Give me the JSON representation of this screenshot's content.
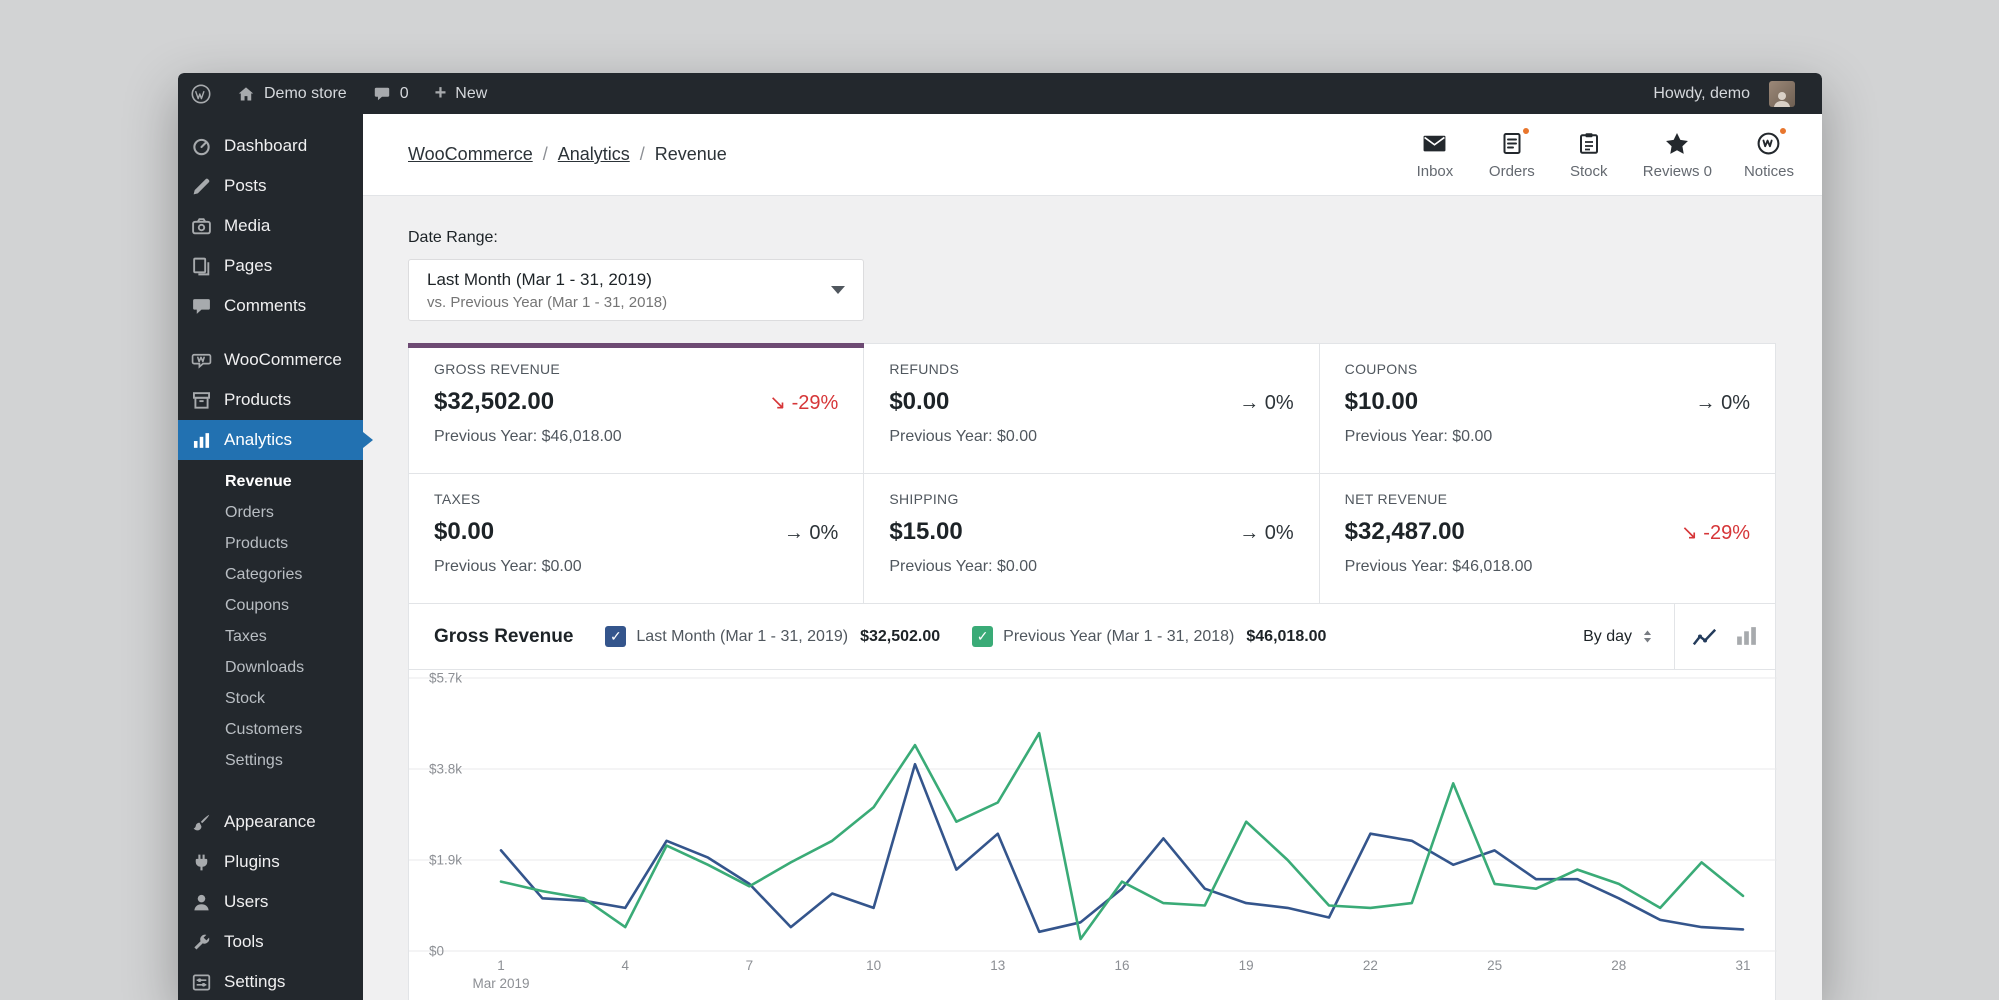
{
  "colors": {
    "accent": "#6d4a73",
    "series_current": "#34558c",
    "series_previous": "#3aab77",
    "negative": "#d63638",
    "badge": "#e8762d",
    "active_menu": "#2271b1"
  },
  "admin_bar": {
    "site_name": "Demo store",
    "comments_count": "0",
    "new_prefix": "+",
    "new_label": "New",
    "howdy": "Howdy, demo"
  },
  "sidebar": {
    "items": [
      {
        "label": "Dashboard"
      },
      {
        "label": "Posts"
      },
      {
        "label": "Media"
      },
      {
        "label": "Pages"
      },
      {
        "label": "Comments"
      },
      {
        "label": "WooCommerce"
      },
      {
        "label": "Products"
      },
      {
        "label": "Analytics"
      },
      {
        "label": "Appearance"
      },
      {
        "label": "Plugins"
      },
      {
        "label": "Users"
      },
      {
        "label": "Tools"
      },
      {
        "label": "Settings"
      }
    ],
    "analytics_submenu": [
      {
        "label": "Revenue"
      },
      {
        "label": "Orders"
      },
      {
        "label": "Products"
      },
      {
        "label": "Categories"
      },
      {
        "label": "Coupons"
      },
      {
        "label": "Taxes"
      },
      {
        "label": "Downloads"
      },
      {
        "label": "Stock"
      },
      {
        "label": "Customers"
      },
      {
        "label": "Settings"
      }
    ]
  },
  "breadcrumb": {
    "root": "WooCommerce",
    "section": "Analytics",
    "current": "Revenue",
    "separator": "/"
  },
  "activity": {
    "inbox": "Inbox",
    "orders": "Orders",
    "stock": "Stock",
    "reviews": "Reviews 0",
    "notices": "Notices"
  },
  "date_range": {
    "label": "Date Range:",
    "primary": "Last Month (Mar 1 - 31, 2019)",
    "secondary": "vs. Previous Year (Mar 1 - 31, 2018)"
  },
  "summary_cards": [
    {
      "label": "GROSS REVENUE",
      "value": "$32,502.00",
      "arrow": "↘",
      "pct": "-29%",
      "previous": "Previous Year: $46,018.00"
    },
    {
      "label": "REFUNDS",
      "value": "$0.00",
      "arrow": "→",
      "pct": "0%",
      "previous": "Previous Year: $0.00"
    },
    {
      "label": "COUPONS",
      "value": "$10.00",
      "arrow": "→",
      "pct": "0%",
      "previous": "Previous Year: $0.00"
    },
    {
      "label": "TAXES",
      "value": "$0.00",
      "arrow": "→",
      "pct": "0%",
      "previous": "Previous Year: $0.00"
    },
    {
      "label": "SHIPPING",
      "value": "$15.00",
      "arrow": "→",
      "pct": "0%",
      "previous": "Previous Year: $0.00"
    },
    {
      "label": "NET REVENUE",
      "value": "$32,487.00",
      "arrow": "↘",
      "pct": "-29%",
      "previous": "Previous Year: $46,018.00"
    }
  ],
  "chart": {
    "title": "Gross Revenue",
    "check_glyph": "✓",
    "interval": "By day",
    "legend": [
      {
        "label": "Last Month (Mar 1 - 31, 2019)",
        "total": "$32,502.00"
      },
      {
        "label": "Previous Year (Mar 1 - 31, 2018)",
        "total": "$46,018.00"
      }
    ]
  },
  "chart_data": {
    "type": "line",
    "title": "Gross Revenue",
    "x_label_month": "Mar 2019",
    "x": [
      1,
      2,
      3,
      4,
      5,
      6,
      7,
      8,
      9,
      10,
      11,
      12,
      13,
      14,
      15,
      16,
      17,
      18,
      19,
      20,
      21,
      22,
      23,
      24,
      25,
      26,
      27,
      28,
      29,
      30,
      31
    ],
    "x_ticks": [
      1,
      4,
      7,
      10,
      13,
      16,
      19,
      22,
      25,
      28,
      31
    ],
    "y_ticks": [
      {
        "v": 0,
        "label": "$0"
      },
      {
        "v": 1900,
        "label": "$1.9k"
      },
      {
        "v": 3800,
        "label": "$3.8k"
      },
      {
        "v": 5700,
        "label": "$5.7k"
      }
    ],
    "ylim": [
      0,
      5700
    ],
    "grid": true,
    "legend_position": "top",
    "series": [
      {
        "name": "Last Month (Mar 1 - 31, 2019)",
        "color": "#34558c",
        "values": [
          2100,
          1100,
          1050,
          900,
          2300,
          1950,
          1400,
          500,
          1200,
          900,
          3900,
          1700,
          2450,
          400,
          600,
          1300,
          2350,
          1300,
          1000,
          900,
          700,
          2450,
          2300,
          1800,
          2100,
          1500,
          1500,
          1100,
          650,
          500,
          450
        ]
      },
      {
        "name": "Previous Year (Mar 1 - 31, 2018)",
        "color": "#3aab77",
        "values": [
          1450,
          1250,
          1100,
          500,
          2200,
          1800,
          1350,
          1850,
          2300,
          3000,
          4300,
          2700,
          3100,
          4550,
          250,
          1450,
          1000,
          950,
          2700,
          1900,
          950,
          900,
          1000,
          3500,
          1400,
          1300,
          1700,
          1400,
          900,
          1850,
          1150
        ]
      }
    ]
  }
}
